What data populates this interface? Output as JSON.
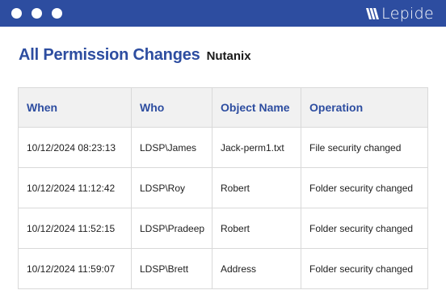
{
  "window": {
    "controls": [
      "close",
      "minimize",
      "maximize"
    ],
    "brand": {
      "icon": "lepide-logo-icon",
      "name": "Lepide"
    }
  },
  "report": {
    "title": "All Permission Changes",
    "source": "Nutanix"
  },
  "table": {
    "columns": [
      "When",
      "Who",
      "Object Name",
      "Operation"
    ],
    "rows": [
      [
        "10/12/2024 08:23:13",
        "LDSP\\James",
        "Jack-perm1.txt",
        "File security changed"
      ],
      [
        "10/12/2024 11:12:42",
        "LDSP\\Roy",
        "Robert",
        "Folder security changed"
      ],
      [
        "10/12/2024 11:52:15",
        "LDSP\\Pradeep",
        "Robert",
        "Folder security changed"
      ],
      [
        "10/12/2024 11:59:07",
        "LDSP\\Brett",
        "Address",
        "Folder security changed"
      ]
    ]
  },
  "colors": {
    "accent": "#2d4da0",
    "header_bg": "#f1f1f1",
    "border": "#d9d9d9"
  }
}
